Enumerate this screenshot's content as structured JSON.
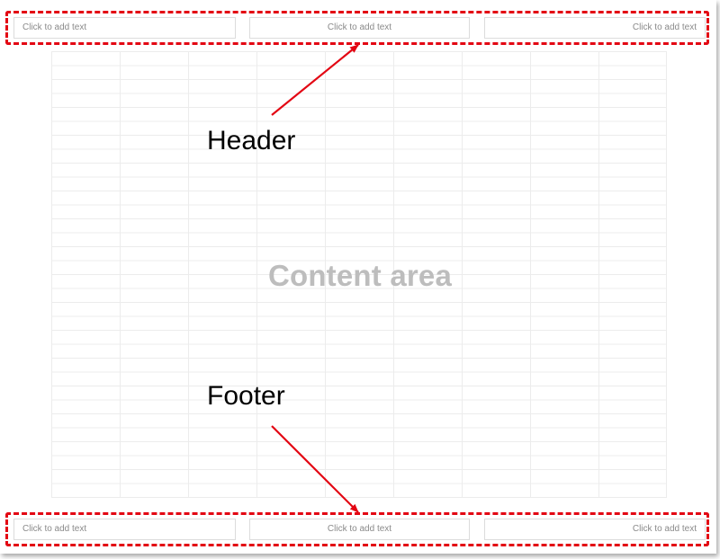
{
  "header": {
    "left_placeholder": "Click to add text",
    "center_placeholder": "Click to add text",
    "right_placeholder": "Click to add text"
  },
  "footer": {
    "left_placeholder": "Click to add text",
    "center_placeholder": "Click to add text",
    "right_placeholder": "Click to add text"
  },
  "content": {
    "label": "Content area"
  },
  "annotations": {
    "header_label": "Header",
    "footer_label": "Footer"
  },
  "colors": {
    "highlight": "#e30613",
    "arrow": "#e30613",
    "content_label": "#bdbdbd",
    "placeholder_text": "#8a8a8a"
  }
}
